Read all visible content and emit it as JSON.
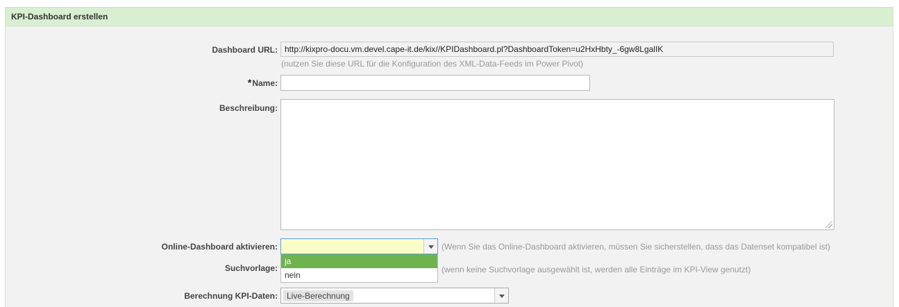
{
  "panel": {
    "title": "KPI-Dashboard erstellen"
  },
  "form": {
    "dashboard_url": {
      "label": "Dashboard URL:",
      "value": "http://kixpro-docu.vm.devel.cape-it.de/kix//KPIDashboard.pl?DashboardToken=u2HxHbty_-6gw8LgalIK",
      "hint": "(nutzen Sie diese URL für die Konfiguration des XML-Data-Feeds im Power Pivot)"
    },
    "name": {
      "required_mark": "*",
      "label": "Name:",
      "value": ""
    },
    "description": {
      "label": "Beschreibung:",
      "value": ""
    },
    "online_dashboard": {
      "label": "Online-Dashboard aktivieren:",
      "selected": "",
      "hint": "(Wenn Sie das Online-Dashboard aktivieren, müssen Sie sicherstellen, dass das Datenset kompatibel ist)",
      "options": [
        "ja",
        "nein"
      ],
      "highlighted_option": "ja"
    },
    "search_template": {
      "label": "Suchvorlage:",
      "hint": "(wenn keine Suchvorlage ausgewählt ist, werden alle Einträge im KPI-View genutzt)"
    },
    "kpi_calc": {
      "label": "Berechnung KPI-Daten:",
      "selected": "Live-Berechnung"
    }
  },
  "colors": {
    "header_bg": "#d9efd2",
    "panel_bg": "#f2f2f2",
    "active_select_bg": "#fbfdc8",
    "selected_option_bg": "#6fb34f"
  }
}
